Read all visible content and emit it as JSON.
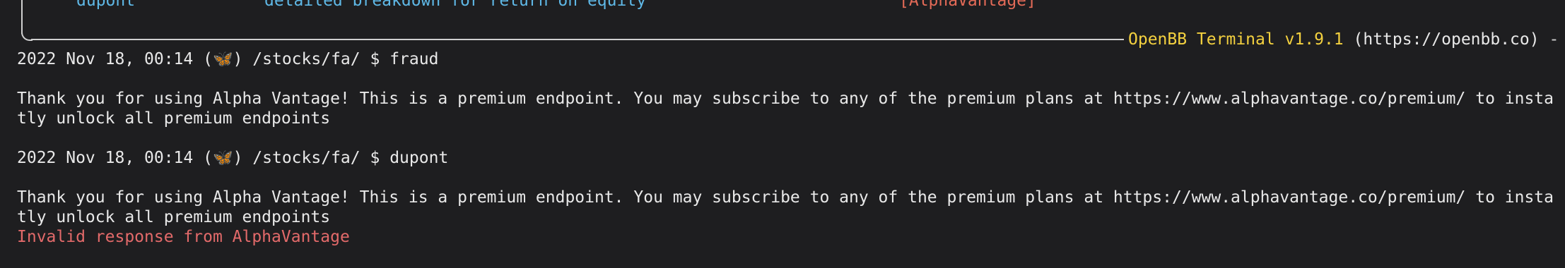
{
  "menu_row": {
    "command": "dupont",
    "description": "detailed breakdown for return on equity",
    "source": "[AlphaVantage]"
  },
  "footer": {
    "version": "OpenBB Terminal v1.9.1",
    "url": "(https://openbb.co)",
    "trail": " -"
  },
  "session": [
    {
      "timestamp": "2022 Nov 18, 00:14",
      "icon": "butterfly-icon",
      "path": "/stocks/fa/",
      "symbol": "$",
      "command": "fraud",
      "output": [
        "Thank you for using Alpha Vantage! This is a premium endpoint. You may subscribe to any of the premium plans at https://www.alphavantage.co/premium/ to insta",
        "tly unlock all premium endpoints"
      ]
    },
    {
      "timestamp": "2022 Nov 18, 00:14",
      "icon": "butterfly-icon",
      "path": "/stocks/fa/",
      "symbol": "$",
      "command": "dupont",
      "output": [
        "Thank you for using Alpha Vantage! This is a premium endpoint. You may subscribe to any of the premium plans at https://www.alphavantage.co/premium/ to insta",
        "tly unlock all premium endpoints"
      ],
      "error": "Invalid response from AlphaVantage"
    }
  ],
  "colors": {
    "background": "#1e1e20",
    "command": "#5fb8e6",
    "source": "#e36a57",
    "version": "#f4d13f",
    "error": "#e36a6a",
    "butterfly": "#3fa9f5"
  }
}
